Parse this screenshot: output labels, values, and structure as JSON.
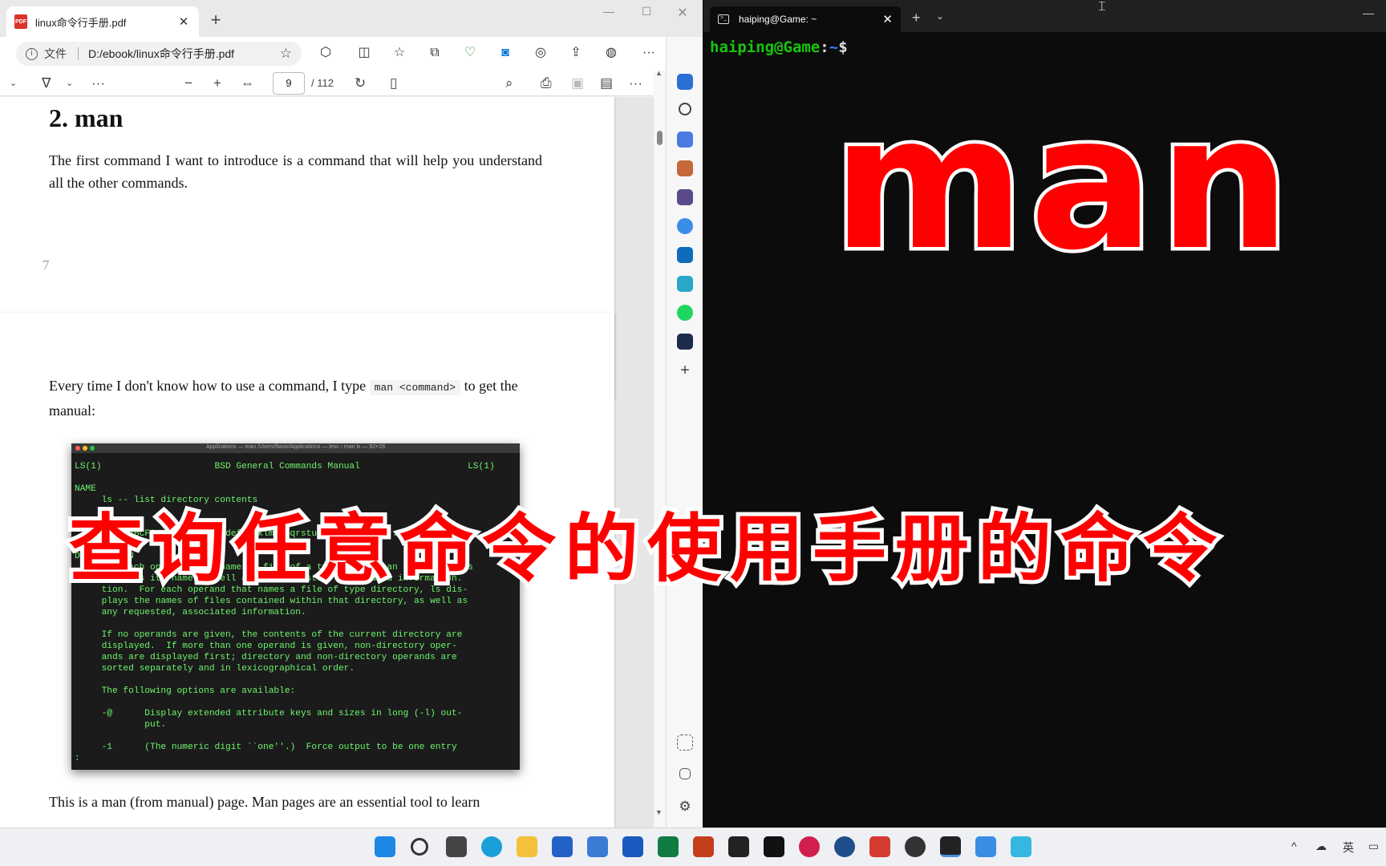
{
  "edge": {
    "tab_title": "linux命令行手册.pdf",
    "tab_close": "✕",
    "new_tab": "+",
    "file_label": "文件",
    "url": "D:/ebook/linux命令行手册.pdf",
    "page_current": "9",
    "page_total": "/ 112"
  },
  "pdf": {
    "heading": "2. man",
    "para1": "The first command I want to introduce is a command that will help you understand all the other commands.",
    "page_number": "7",
    "para2_before": "Every time I don't know how to use a command, I type",
    "para2_code": "man <command>",
    "para2_after": "to get the manual:",
    "image_titlebar": "Applications — man /Users/flavio/Applications — less ‹ man ls — 82×28",
    "man_lines": [
      "LS(1)                     BSD General Commands Manual                    LS(1)",
      "",
      "NAME",
      "     ls -- list directory contents",
      "",
      "SYNOPSIS",
      "     ls [-ABCFGHLOPRSTUW@abcdefghiklmnopqrstuwx1%] [file ...]",
      "",
      "DESCRIPTION",
      "     For each operand that names a file of a type other than directory, ls",
      "     displays its name as well as any requested, associated information.",
      "     tion.  For each operand that names a file of type directory, ls dis-",
      "     plays the names of files contained within that directory, as well as",
      "     any requested, associated information.",
      "",
      "     If no operands are given, the contents of the current directory are",
      "     displayed.  If more than one operand is given, non-directory oper-",
      "     ands are displayed first; directory and non-directory operands are",
      "     sorted separately and in lexicographical order.",
      "",
      "     The following options are available:",
      "",
      "     -@      Display extended attribute keys and sizes in long (-l) out-",
      "             put.",
      "",
      "     -1      (The numeric digit ``one''.)  Force output to be one entry",
      ":"
    ],
    "para3": "This is a man (from manual) page. Man pages are an essential tool to learn"
  },
  "terminal": {
    "tab_title": "haiping@Game: ~",
    "tab_close": "✕",
    "new_tab": "+",
    "prompt_user": "haiping@Game",
    "prompt_colon": ":",
    "prompt_path": "~",
    "prompt_symbol": "$"
  },
  "overlay": {
    "big_title": "man",
    "subtitle": "查询任意命令的使用手册的命令"
  },
  "taskbar": {
    "tray_lang": "英"
  },
  "colors": {
    "caption_red": "#ff0000",
    "terminal_green": "#16c60c",
    "man_green": "#6cf56c"
  }
}
